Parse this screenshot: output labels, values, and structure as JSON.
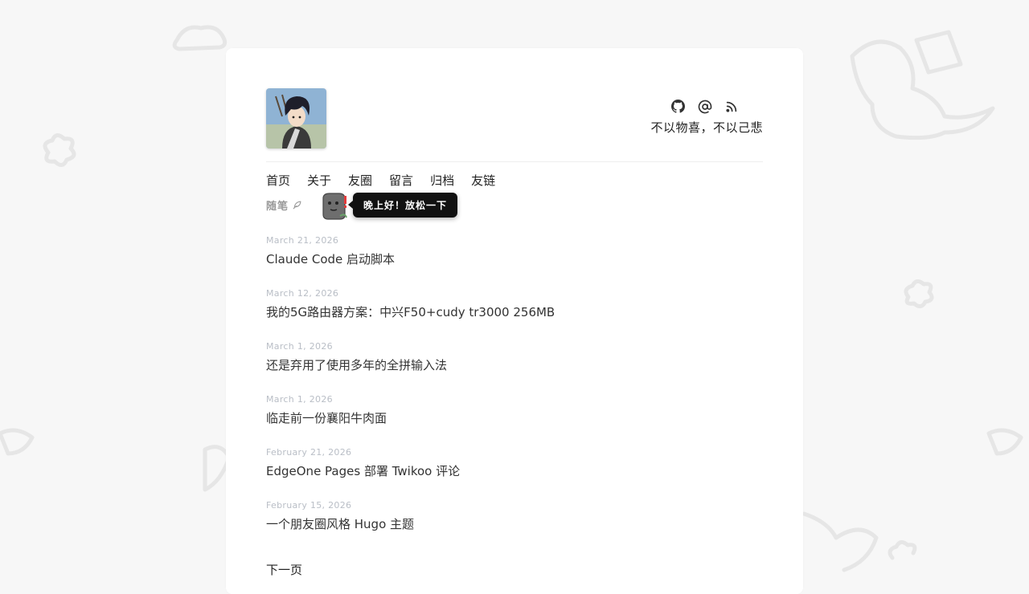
{
  "header": {
    "avatar_alt": "avatar",
    "icons": [
      "github-icon",
      "at-icon",
      "rss-icon"
    ],
    "motto": "不以物喜，不以己悲"
  },
  "nav": [
    "首页",
    "关于",
    "友圈",
    "留言",
    "归档",
    "友链"
  ],
  "section": {
    "label": "随笔",
    "greeting": "晚上好！放松一下"
  },
  "posts": [
    {
      "date": "March 21, 2026",
      "title": "Claude Code 启动脚本"
    },
    {
      "date": "March 12, 2026",
      "title": "我的5G路由器方案：中兴F50+cudy tr3000 256MB"
    },
    {
      "date": "March 1, 2026",
      "title": "还是弃用了使用多年的全拼输入法"
    },
    {
      "date": "March 1, 2026",
      "title": "临走前一份襄阳牛肉面"
    },
    {
      "date": "February 21, 2026",
      "title": "EdgeOne Pages 部署 Twikoo 评论"
    },
    {
      "date": "February 15, 2026",
      "title": "一个朋友圈风格 Hugo 主题"
    }
  ],
  "pagination": {
    "next": "下一页"
  },
  "colors": {
    "background": "#f7f7f7",
    "card": "#ffffff",
    "date": "#b9bec6",
    "bubble": "#111111"
  }
}
